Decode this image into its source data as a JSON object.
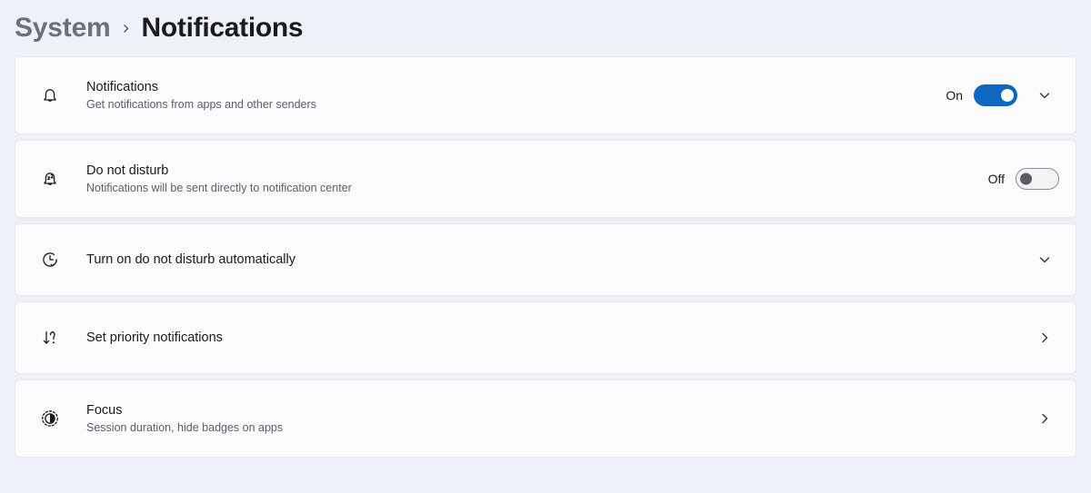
{
  "breadcrumb": {
    "parent": "System",
    "separator_icon": "chevron-right-icon",
    "current": "Notifications"
  },
  "accent_color": "#0f68c0",
  "page_background": "#eff1f8",
  "card_background": "#fbfbfd",
  "settings": [
    {
      "id": "notifications",
      "icon": "bell-icon",
      "title": "Notifications",
      "subtitle": "Get notifications from apps and other senders",
      "control": "toggle",
      "toggle_state": "On",
      "expander_icon": "chevron-down-icon"
    },
    {
      "id": "do-not-disturb",
      "icon": "bell-sleep-icon",
      "title": "Do not disturb",
      "subtitle": "Notifications will be sent directly to notification center",
      "control": "toggle",
      "toggle_state": "Off",
      "expander_icon": ""
    },
    {
      "id": "turn-on-do-not-disturb-automatically",
      "icon": "clock-schedule-icon",
      "title": "Turn on do not disturb automatically",
      "subtitle": "",
      "control": "expander",
      "toggle_state": "",
      "expander_icon": "chevron-down-icon"
    },
    {
      "id": "set-priority-notifications",
      "icon": "priority-arrow-icon",
      "title": "Set priority notifications",
      "subtitle": "",
      "control": "navigate",
      "toggle_state": "",
      "expander_icon": "chevron-right-icon"
    },
    {
      "id": "focus",
      "icon": "focus-icon",
      "title": "Focus",
      "subtitle": "Session duration, hide badges on apps",
      "control": "navigate",
      "toggle_state": "",
      "expander_icon": "chevron-right-icon"
    }
  ]
}
